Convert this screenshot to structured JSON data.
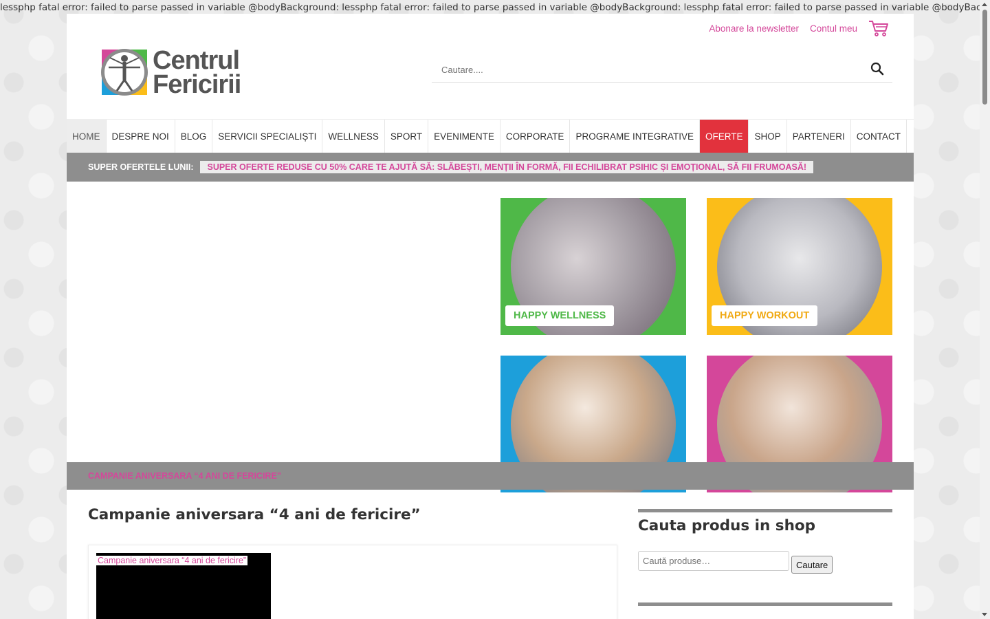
{
  "error_message": "lessphp fatal error: failed to parse passed in variable @bodyBackground: lessphp fatal error: failed to parse passed in variable @bodyBackground: lessphp fatal error: failed to parse passed in variable @bodyBackground:",
  "header": {
    "newsletter_link": "Abonare la newsletter",
    "account_link": "Contul meu",
    "cart_icon": "cart-icon",
    "logo_text_line1": "Centrul",
    "logo_text_line2": "Fericirii",
    "search": {
      "placeholder": "Cautare....",
      "value": ""
    }
  },
  "nav": {
    "items": [
      {
        "label": "HOME"
      },
      {
        "label": "DESPRE NOI"
      },
      {
        "label": "BLOG"
      },
      {
        "label": "SERVICII SPECIALIȘTI"
      },
      {
        "label": "WELLNESS"
      },
      {
        "label": "SPORT"
      },
      {
        "label": "EVENIMENTE"
      },
      {
        "label": "CORPORATE"
      },
      {
        "label": "PROGRAME INTEGRATIVE"
      },
      {
        "label": "OFERTE"
      },
      {
        "label": "SHOP"
      },
      {
        "label": "PARTENERI"
      },
      {
        "label": "CONTACT"
      }
    ]
  },
  "ticker": {
    "label": "SUPER OFERTELE LUNII:",
    "message": "SUPER OFERTE REDUSE CU 50% CARE TE AJUTĂ SĂ: SLĂBEȘTI, MENȚII ÎN FORMĂ, FII ECHILIBRAT PSIHIC ȘI EMOȚIONAL, SĂ FII FRUMOASĂ!"
  },
  "tiles": [
    {
      "label": "HAPPY WELLNESS",
      "color": "#4fb848"
    },
    {
      "label": "HAPPY WORKOUT",
      "color": "#fbbd19"
    },
    {
      "label": "",
      "color": "#1d9fda"
    },
    {
      "label": "",
      "color": "#d4479a"
    }
  ],
  "breadcrumb": "CAMPANIE ANIVERSARA “4 ANI DE FERICIRE”",
  "article": {
    "title": "Campanie aniversara “4 ani de fericire”",
    "image_alt": "Campanie aniversara “4 ani de fericire”"
  },
  "sidebar": {
    "title": "Cauta produs in shop",
    "search_placeholder": "Caută produse…",
    "search_button": "Cautare"
  },
  "colors": {
    "accent_pink": "#d4479a",
    "offer_red": "#e2323d",
    "bar_gray": "#8e8e8e"
  }
}
